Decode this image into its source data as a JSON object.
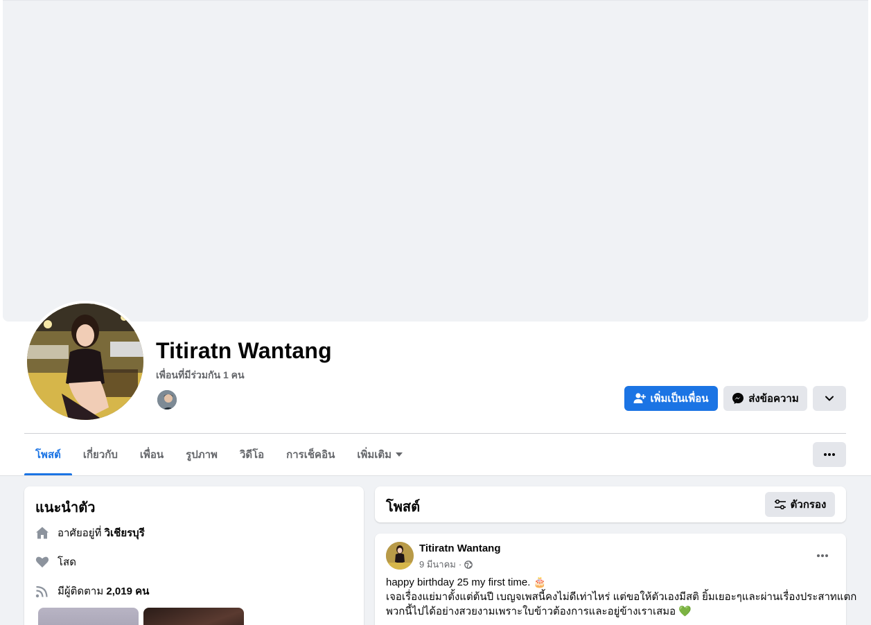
{
  "profile": {
    "name": "Titiratn Wantang",
    "mutual_friends": "เพื่อนที่มีร่วมกัน 1 คน"
  },
  "actions": {
    "add_friend": "เพิ่มเป็นเพื่อน",
    "message": "ส่งข้อความ"
  },
  "tabs": [
    {
      "label": "โพสต์",
      "active": true
    },
    {
      "label": "เกี่ยวกับ"
    },
    {
      "label": "เพื่อน"
    },
    {
      "label": "รูปภาพ"
    },
    {
      "label": "วิดีโอ"
    },
    {
      "label": "การเช็คอิน"
    },
    {
      "label": "เพิ่มเติม"
    }
  ],
  "intro": {
    "title": "แนะนำตัว",
    "lives_in_prefix": "อาศัยอยู่ที่",
    "lives_in_place": "วิเชียรบุรี",
    "relationship": "โสด",
    "followers_prefix": "มีผู้ติดตาม",
    "followers_count": "2,019 คน"
  },
  "posts_section": {
    "title": "โพสต์",
    "filter_label": "ตัวกรอง"
  },
  "post": {
    "author": "Titiratn Wantang",
    "date": "9 มีนาคม",
    "separator": "·",
    "line1": "happy birthday 25 my first time. 🎂",
    "line2": "เจอเรื่องแย่มาตั้งแต่ต้นปี เบญจเพสนี้คงไม่ดีเท่าไหร่ แต่ขอให้ตัวเองมีสติ ยิ้มเยอะๆและผ่านเรื่องประสาทแตก",
    "line3": "พวกนี้ไปได้อย่างสวยงามเพราะใบข้าวต้องการและอยู่ข้างเราเสมอ 💚"
  },
  "colors": {
    "accent": "#1b74e4",
    "background": "#f0f2f5",
    "secondary_text": "#65676b",
    "button_gray": "#e4e6eb"
  }
}
